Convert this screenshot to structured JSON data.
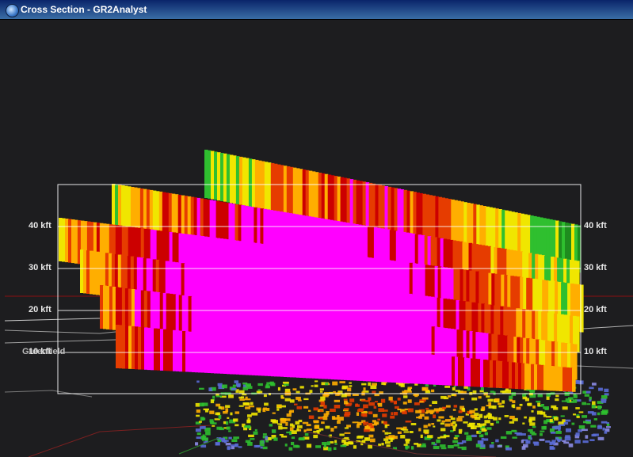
{
  "window": {
    "title": "Cross Section - GR2Analyst"
  },
  "axis": {
    "left_labels": [
      "40 kft",
      "30 kft",
      "20 kft",
      "10 kft"
    ],
    "right_labels": [
      "40 kft",
      "30 kft",
      "20 kft",
      "10 kft"
    ],
    "heights_kft": [
      40,
      30,
      20,
      10
    ]
  },
  "map": {
    "city_label": "Greenfield"
  },
  "colors": {
    "background": "#1d1d1f",
    "frame": "#ffffff",
    "palette": [
      "#8c8ce6",
      "#5a6cd6",
      "#1e8c1e",
      "#2fbf2f",
      "#f0e600",
      "#ffae00",
      "#e63c00",
      "#cc0000",
      "#ff00ff"
    ]
  }
}
